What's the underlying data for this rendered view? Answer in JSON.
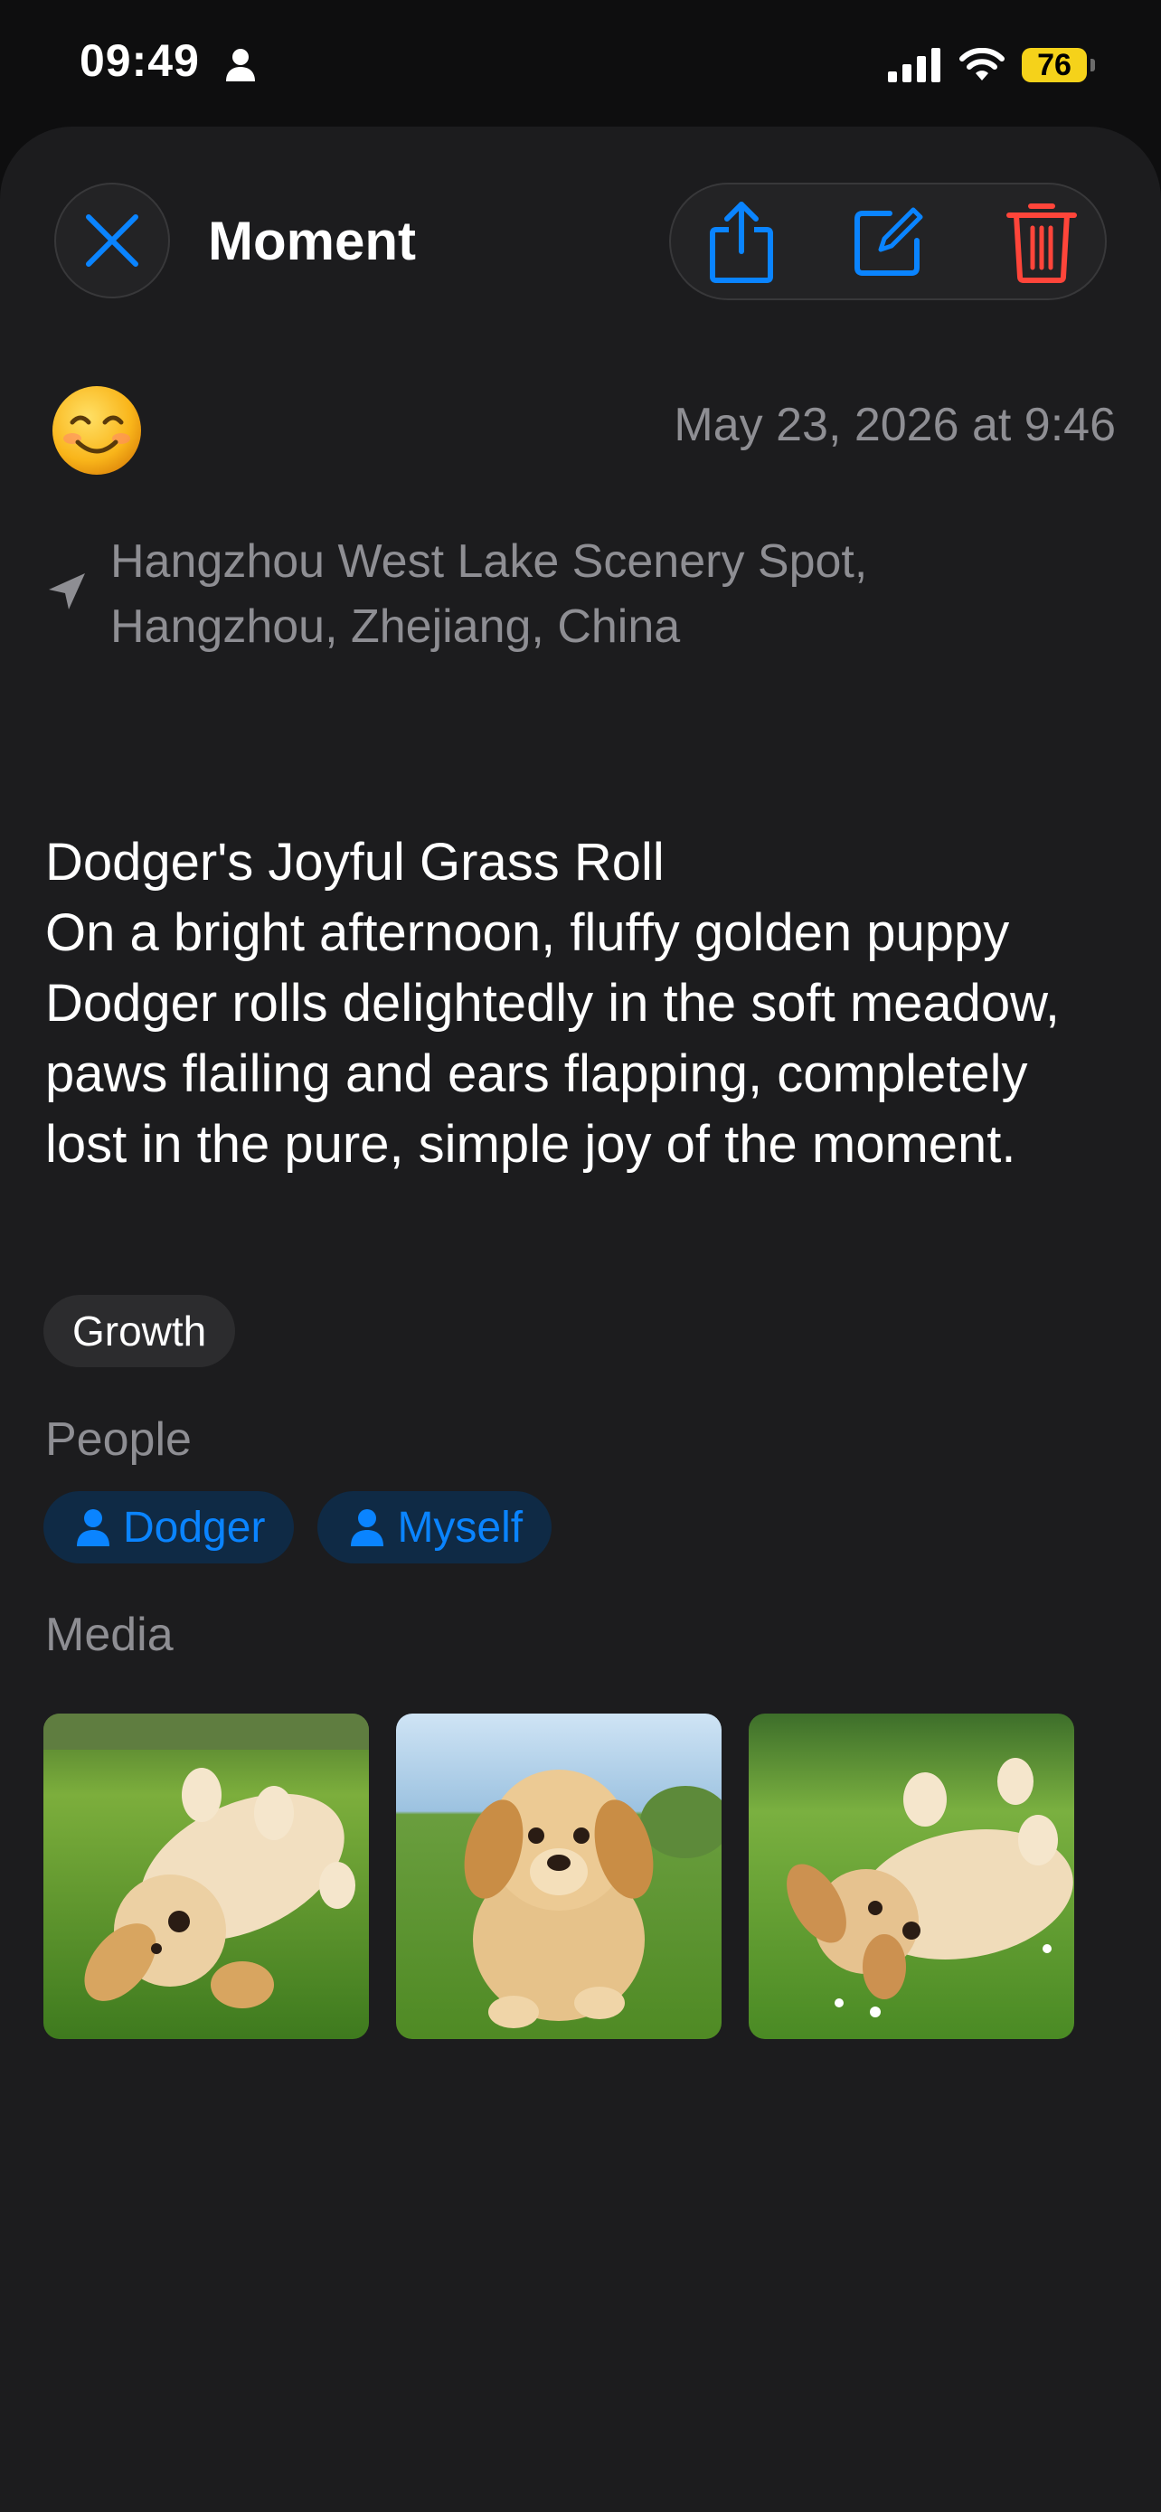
{
  "status_bar": {
    "time": "09:49",
    "battery": "76",
    "icons": [
      "person-icon",
      "signal-icon",
      "wifi-icon",
      "battery-icon"
    ]
  },
  "header": {
    "title": "Moment",
    "close_icon": "close-icon",
    "actions": [
      "share-icon",
      "edit-icon",
      "trash-icon"
    ]
  },
  "moment": {
    "mood_icon": "smiling-face-icon",
    "date": "May 23, 2026 at 9:46",
    "location_line1": "Hangzhou West Lake Scenery Spot,",
    "location_line2": "Hangzhou, Zhejiang, China",
    "title": "Dodger's Joyful Grass Roll",
    "body": "On a bright afternoon, fluffy golden puppy Dodger rolls delightedly in the soft meadow, paws flailing and ears flapping, completely lost in the pure, simple joy of the moment.",
    "tag": "Growth"
  },
  "people": {
    "label": "People",
    "items": [
      "Dodger",
      "Myself"
    ]
  },
  "media": {
    "label": "Media",
    "items": [
      "puppy-rolling-on-back-photo",
      "puppy-walking-photo",
      "puppy-rolling-photo"
    ]
  },
  "colors": {
    "accent": "#0a84ff",
    "destructive": "#ff453a",
    "battery": "#f5d21a",
    "sheet_background": "#1c1c1e"
  }
}
